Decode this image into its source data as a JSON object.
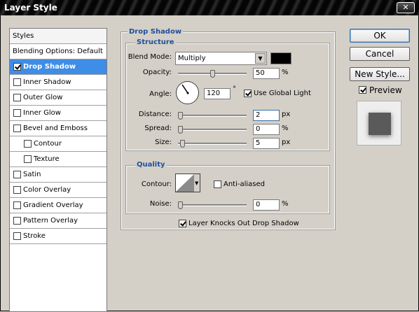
{
  "window": {
    "title": "Layer Style",
    "close_glyph": "✕"
  },
  "styles_panel": {
    "header": "Styles",
    "items": [
      {
        "label": "Blending Options: Default",
        "checkbox": false,
        "checked": false,
        "indent": false,
        "selected": false
      },
      {
        "label": "Drop Shadow",
        "checkbox": true,
        "checked": true,
        "indent": false,
        "selected": true
      },
      {
        "label": "Inner Shadow",
        "checkbox": true,
        "checked": false,
        "indent": false,
        "selected": false
      },
      {
        "label": "Outer Glow",
        "checkbox": true,
        "checked": false,
        "indent": false,
        "selected": false
      },
      {
        "label": "Inner Glow",
        "checkbox": true,
        "checked": false,
        "indent": false,
        "selected": false
      },
      {
        "label": "Bevel and Emboss",
        "checkbox": true,
        "checked": false,
        "indent": false,
        "selected": false
      },
      {
        "label": "Contour",
        "checkbox": true,
        "checked": false,
        "indent": true,
        "selected": false
      },
      {
        "label": "Texture",
        "checkbox": true,
        "checked": false,
        "indent": true,
        "selected": false
      },
      {
        "label": "Satin",
        "checkbox": true,
        "checked": false,
        "indent": false,
        "selected": false
      },
      {
        "label": "Color Overlay",
        "checkbox": true,
        "checked": false,
        "indent": false,
        "selected": false
      },
      {
        "label": "Gradient Overlay",
        "checkbox": true,
        "checked": false,
        "indent": false,
        "selected": false
      },
      {
        "label": "Pattern Overlay",
        "checkbox": true,
        "checked": false,
        "indent": false,
        "selected": false
      },
      {
        "label": "Stroke",
        "checkbox": true,
        "checked": false,
        "indent": false,
        "selected": false
      }
    ]
  },
  "drop_shadow": {
    "title": "Drop Shadow",
    "structure": {
      "title": "Structure",
      "blend_mode_label": "Blend Mode:",
      "blend_mode_value": "Multiply",
      "shadow_color": "#000000",
      "opacity_label": "Opacity:",
      "opacity_value": "50",
      "opacity_unit": "%",
      "opacity_fraction": 0.5,
      "angle_label": "Angle:",
      "angle_value": "120",
      "angle_unit": "°",
      "use_global_light_label": "Use Global Light",
      "use_global_light_checked": true,
      "distance_label": "Distance:",
      "distance_value": "2",
      "distance_unit": "px",
      "distance_fraction": 0.0,
      "spread_label": "Spread:",
      "spread_value": "0",
      "spread_unit": "%",
      "spread_fraction": 0.0,
      "size_label": "Size:",
      "size_value": "5",
      "size_unit": "px",
      "size_fraction": 0.03
    },
    "quality": {
      "title": "Quality",
      "contour_label": "Contour:",
      "anti_aliased_label": "Anti-aliased",
      "anti_aliased_checked": false,
      "noise_label": "Noise:",
      "noise_value": "0",
      "noise_unit": "%",
      "noise_fraction": 0.0
    },
    "knocks_out_label": "Layer Knocks Out Drop Shadow",
    "knocks_out_checked": true
  },
  "buttons": {
    "ok": "OK",
    "cancel": "Cancel",
    "new_style": "New Style..."
  },
  "preview": {
    "label": "Preview",
    "checked": true
  }
}
